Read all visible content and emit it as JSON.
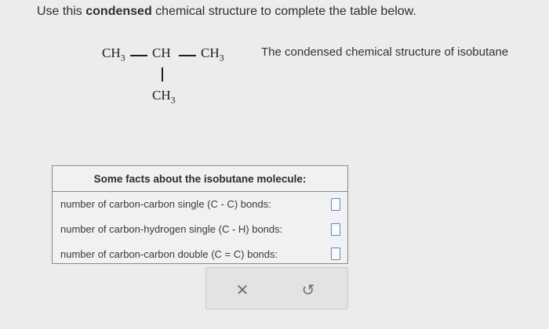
{
  "instruction": {
    "prefix": "Use this ",
    "bold": "condensed",
    "suffix": " chemical structure to complete the table below."
  },
  "structure": {
    "left_group": "CH",
    "left_sub": "3",
    "center_group": "CH",
    "right_group": "CH",
    "right_sub": "3",
    "bottom_group": "CH",
    "bottom_sub": "3",
    "caption": "The condensed chemical structure of isobutane"
  },
  "facts_table": {
    "heading": "Some facts about the isobutane molecule:",
    "rows": [
      {
        "label": "number of carbon-carbon single (C - C) bonds:",
        "value": ""
      },
      {
        "label": "number of carbon-hydrogen single (C - H) bonds:",
        "value": ""
      },
      {
        "label": "number of carbon-carbon double (C = C) bonds:",
        "value": ""
      }
    ]
  },
  "buttons": {
    "clear_icon": "close-icon",
    "clear_glyph": "✕",
    "undo_icon": "undo-icon",
    "undo_glyph": "↺"
  },
  "colors": {
    "background": "#ececec",
    "input_border": "#5b8ac4",
    "button_icon": "#6a7580"
  }
}
